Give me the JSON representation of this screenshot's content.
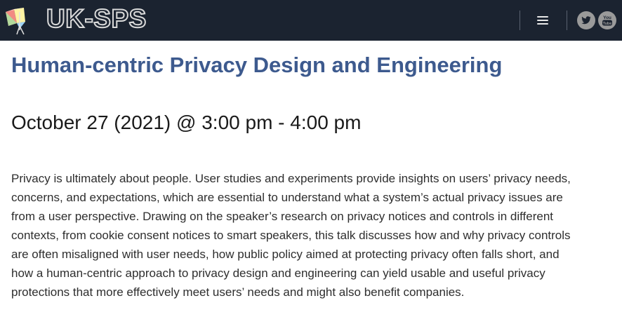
{
  "header": {
    "site_name": "UK-SPS",
    "background_color": "#1b2330",
    "icons": {
      "logo": "logo-mark",
      "menu": "hamburger-menu-icon",
      "twitter": "twitter-icon",
      "youtube": "youtube-icon"
    }
  },
  "event": {
    "title": "Human-centric Privacy Design and Engineering",
    "title_color": "#3d5a8e",
    "date_time": "October 27 (2021) @ 3:00 pm - 4:00 pm",
    "description_lines": [
      "Privacy is ultimately about people. User studies and experiments provide insights on users’ privacy needs,",
      "concerns, and expectations, which are essential to understand what a system’s actual privacy issues are",
      "from a user perspective. Drawing on the speaker’s research on privacy notices and controls in different",
      "contexts, from cookie consent notices to smart speakers, this talk discusses how and why privacy controls",
      "are often misaligned with user needs, how public policy aimed at protecting privacy often falls short, and",
      "how a human-centric approach to privacy design and engineering can yield usable and useful privacy",
      "protections that more effectively meet users’ needs and might also benefit companies."
    ]
  }
}
